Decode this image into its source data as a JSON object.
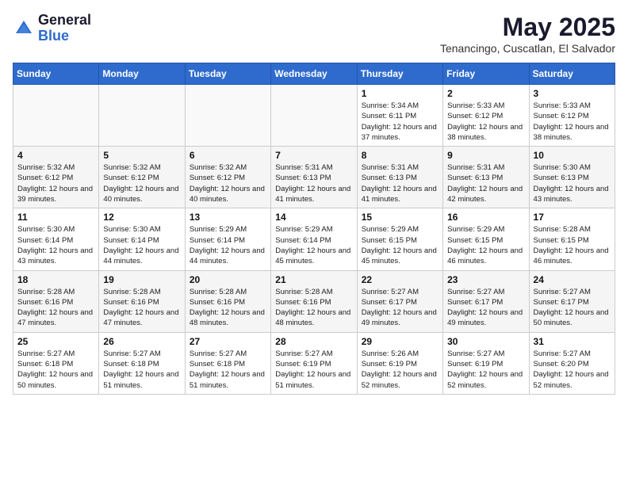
{
  "logo": {
    "general": "General",
    "blue": "Blue"
  },
  "title": "May 2025",
  "subtitle": "Tenancingo, Cuscatlan, El Salvador",
  "days_of_week": [
    "Sunday",
    "Monday",
    "Tuesday",
    "Wednesday",
    "Thursday",
    "Friday",
    "Saturday"
  ],
  "weeks": [
    [
      {
        "day": "",
        "info": ""
      },
      {
        "day": "",
        "info": ""
      },
      {
        "day": "",
        "info": ""
      },
      {
        "day": "",
        "info": ""
      },
      {
        "day": "1",
        "info": "Sunrise: 5:34 AM\nSunset: 6:11 PM\nDaylight: 12 hours\nand 37 minutes."
      },
      {
        "day": "2",
        "info": "Sunrise: 5:33 AM\nSunset: 6:12 PM\nDaylight: 12 hours\nand 38 minutes."
      },
      {
        "day": "3",
        "info": "Sunrise: 5:33 AM\nSunset: 6:12 PM\nDaylight: 12 hours\nand 38 minutes."
      }
    ],
    [
      {
        "day": "4",
        "info": "Sunrise: 5:32 AM\nSunset: 6:12 PM\nDaylight: 12 hours\nand 39 minutes."
      },
      {
        "day": "5",
        "info": "Sunrise: 5:32 AM\nSunset: 6:12 PM\nDaylight: 12 hours\nand 40 minutes."
      },
      {
        "day": "6",
        "info": "Sunrise: 5:32 AM\nSunset: 6:12 PM\nDaylight: 12 hours\nand 40 minutes."
      },
      {
        "day": "7",
        "info": "Sunrise: 5:31 AM\nSunset: 6:13 PM\nDaylight: 12 hours\nand 41 minutes."
      },
      {
        "day": "8",
        "info": "Sunrise: 5:31 AM\nSunset: 6:13 PM\nDaylight: 12 hours\nand 41 minutes."
      },
      {
        "day": "9",
        "info": "Sunrise: 5:31 AM\nSunset: 6:13 PM\nDaylight: 12 hours\nand 42 minutes."
      },
      {
        "day": "10",
        "info": "Sunrise: 5:30 AM\nSunset: 6:13 PM\nDaylight: 12 hours\nand 43 minutes."
      }
    ],
    [
      {
        "day": "11",
        "info": "Sunrise: 5:30 AM\nSunset: 6:14 PM\nDaylight: 12 hours\nand 43 minutes."
      },
      {
        "day": "12",
        "info": "Sunrise: 5:30 AM\nSunset: 6:14 PM\nDaylight: 12 hours\nand 44 minutes."
      },
      {
        "day": "13",
        "info": "Sunrise: 5:29 AM\nSunset: 6:14 PM\nDaylight: 12 hours\nand 44 minutes."
      },
      {
        "day": "14",
        "info": "Sunrise: 5:29 AM\nSunset: 6:14 PM\nDaylight: 12 hours\nand 45 minutes."
      },
      {
        "day": "15",
        "info": "Sunrise: 5:29 AM\nSunset: 6:15 PM\nDaylight: 12 hours\nand 45 minutes."
      },
      {
        "day": "16",
        "info": "Sunrise: 5:29 AM\nSunset: 6:15 PM\nDaylight: 12 hours\nand 46 minutes."
      },
      {
        "day": "17",
        "info": "Sunrise: 5:28 AM\nSunset: 6:15 PM\nDaylight: 12 hours\nand 46 minutes."
      }
    ],
    [
      {
        "day": "18",
        "info": "Sunrise: 5:28 AM\nSunset: 6:16 PM\nDaylight: 12 hours\nand 47 minutes."
      },
      {
        "day": "19",
        "info": "Sunrise: 5:28 AM\nSunset: 6:16 PM\nDaylight: 12 hours\nand 47 minutes."
      },
      {
        "day": "20",
        "info": "Sunrise: 5:28 AM\nSunset: 6:16 PM\nDaylight: 12 hours\nand 48 minutes."
      },
      {
        "day": "21",
        "info": "Sunrise: 5:28 AM\nSunset: 6:16 PM\nDaylight: 12 hours\nand 48 minutes."
      },
      {
        "day": "22",
        "info": "Sunrise: 5:27 AM\nSunset: 6:17 PM\nDaylight: 12 hours\nand 49 minutes."
      },
      {
        "day": "23",
        "info": "Sunrise: 5:27 AM\nSunset: 6:17 PM\nDaylight: 12 hours\nand 49 minutes."
      },
      {
        "day": "24",
        "info": "Sunrise: 5:27 AM\nSunset: 6:17 PM\nDaylight: 12 hours\nand 50 minutes."
      }
    ],
    [
      {
        "day": "25",
        "info": "Sunrise: 5:27 AM\nSunset: 6:18 PM\nDaylight: 12 hours\nand 50 minutes."
      },
      {
        "day": "26",
        "info": "Sunrise: 5:27 AM\nSunset: 6:18 PM\nDaylight: 12 hours\nand 51 minutes."
      },
      {
        "day": "27",
        "info": "Sunrise: 5:27 AM\nSunset: 6:18 PM\nDaylight: 12 hours\nand 51 minutes."
      },
      {
        "day": "28",
        "info": "Sunrise: 5:27 AM\nSunset: 6:19 PM\nDaylight: 12 hours\nand 51 minutes."
      },
      {
        "day": "29",
        "info": "Sunrise: 5:26 AM\nSunset: 6:19 PM\nDaylight: 12 hours\nand 52 minutes."
      },
      {
        "day": "30",
        "info": "Sunrise: 5:27 AM\nSunset: 6:19 PM\nDaylight: 12 hours\nand 52 minutes."
      },
      {
        "day": "31",
        "info": "Sunrise: 5:27 AM\nSunset: 6:20 PM\nDaylight: 12 hours\nand 52 minutes."
      }
    ]
  ]
}
